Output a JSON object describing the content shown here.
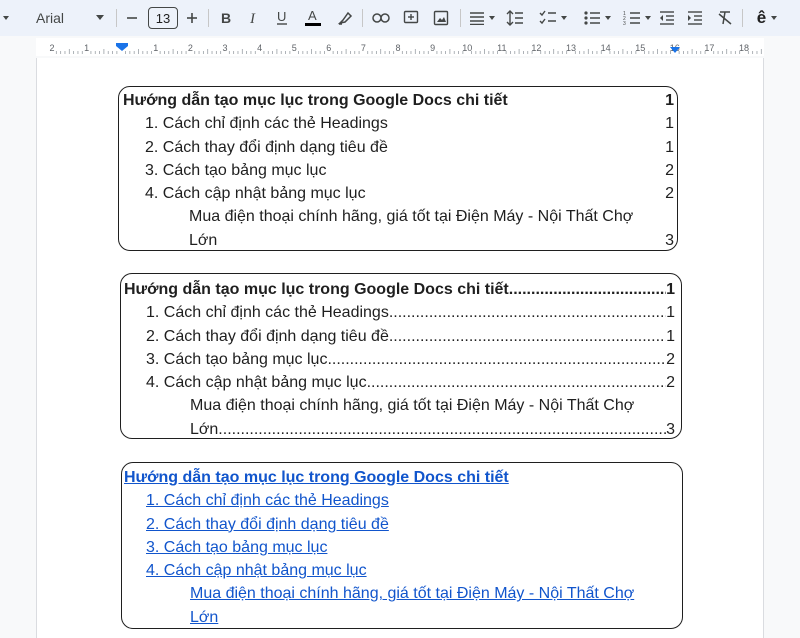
{
  "toolbar": {
    "font_name": "Arial",
    "font_size": "13",
    "icons": [
      "caret-left-icon",
      "minus-icon",
      "plus-icon",
      "bold-icon",
      "italic-icon",
      "underline-icon",
      "text-color-icon",
      "highlight-icon",
      "link-icon",
      "add-comment-icon",
      "insert-image-icon",
      "align-icon",
      "line-spacing-icon",
      "checklist-icon",
      "bulleted-list-icon",
      "numbered-list-icon",
      "decrease-indent-icon",
      "increase-indent-icon",
      "clear-formatting-icon",
      "input-tools-icon"
    ],
    "text_color_bar": "#000000",
    "input_tool_glyph": "ê"
  },
  "ruler": {
    "numbers": [
      "2",
      "1",
      "",
      "1",
      "2",
      "3",
      "4",
      "5",
      "6",
      "7",
      "8",
      "9",
      "10",
      "11",
      "12",
      "13",
      "14",
      "15",
      "16",
      "17",
      "18"
    ],
    "marker_color": "#1a73e8"
  },
  "toc_plain": {
    "entries": [
      {
        "text": "Hướng dẫn tạo mục lục trong Google Docs chi tiết",
        "page": "1"
      },
      {
        "text": "1. Cách chỉ định các thẻ Headings",
        "page": "1"
      },
      {
        "text": "2. Cách thay đổi định dạng tiêu đề",
        "page": "1"
      },
      {
        "text": "3. Cách tạo bảng mục lục",
        "page": "2"
      },
      {
        "text": "4. Cách cập nhật bảng mục lục",
        "page": "2"
      },
      {
        "text": "Mua điện thoại chính hãng, giá tốt tại Điện Máy - Nội Thất Chợ",
        "text_cont": "Lớn",
        "page": "3"
      }
    ]
  },
  "toc_dotted": {
    "entries": [
      {
        "text": "Hướng dẫn tạo mục lục trong Google Docs chi tiết",
        "page": "1"
      },
      {
        "text": "1. Cách chỉ định các thẻ Headings",
        "page": "1"
      },
      {
        "text": "2. Cách thay đổi định dạng tiêu đề",
        "page": "1"
      },
      {
        "text": "3. Cách tạo bảng mục lục",
        "page": "2"
      },
      {
        "text": "4. Cách cập nhật bảng mục lục",
        "page": "2"
      },
      {
        "text": "Mua điện thoại chính hãng, giá tốt tại Điện Máy - Nội Thất Chợ",
        "text_cont": "Lớn",
        "page": "3"
      }
    ]
  },
  "toc_links": {
    "entries": [
      {
        "text": "Hướng dẫn tạo mục lục trong Google Docs chi tiết"
      },
      {
        "text": "1. Cách chỉ định các thẻ Headings"
      },
      {
        "text": "2. Cách thay đổi định dạng tiêu đề"
      },
      {
        "text": "3. Cách tạo bảng mục lục"
      },
      {
        "text": "4. Cách cập nhật bảng mục lục"
      },
      {
        "text": "Mua điện thoại chính hãng, giá tốt tại Điện Máy - Nội Thất Chợ",
        "text_cont": "Lớn"
      }
    ],
    "link_color": "#1155cc"
  },
  "dot_leader": "...................................................................................................................................................................................."
}
